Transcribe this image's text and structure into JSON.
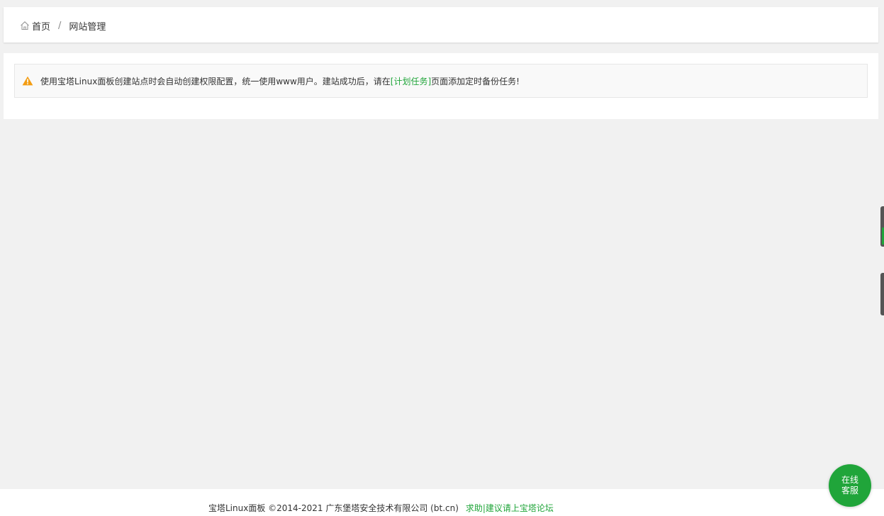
{
  "breadcrumb": {
    "home_label": "首页",
    "separator": "/",
    "current_label": "网站管理"
  },
  "notice": {
    "text_before": "使用宝塔Linux面板创建站点时会自动创建权限配置，统一使用www用户。建站成功后，请在",
    "link_label": "[计划任务]",
    "text_after": "页面添加定时备份任务!",
    "icon": "warning-icon"
  },
  "footer": {
    "copyright": "宝塔Linux面板 ©2014-2021 广东堡塔安全技术有限公司 (bt.cn)",
    "help_link": "求助|建议请上宝塔论坛"
  },
  "chat": {
    "line1": "在线",
    "line2": "客服"
  },
  "colors": {
    "accent": "#20a53a",
    "warning": "#f39c12",
    "page_bg": "#f1f1f1"
  }
}
